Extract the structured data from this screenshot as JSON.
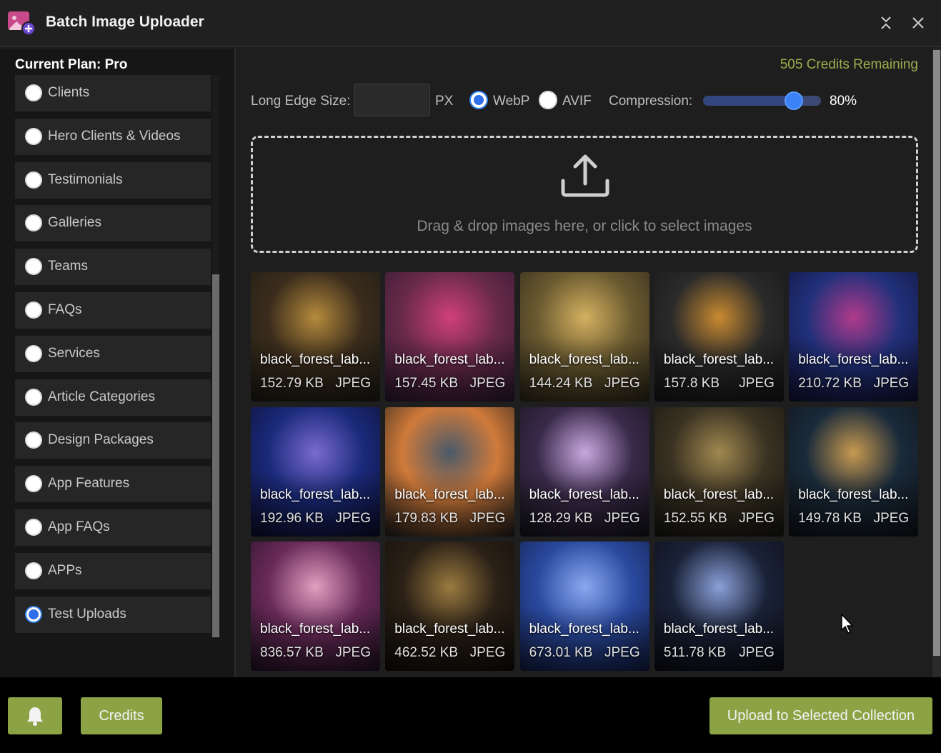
{
  "window": {
    "title": "Batch Image Uploader",
    "icon": "image-add-icon"
  },
  "sidebar": {
    "plan_label": "Current Plan: Pro",
    "collections": [
      {
        "label": "Clients",
        "checked": false
      },
      {
        "label": "Hero Clients & Videos",
        "checked": false
      },
      {
        "label": "Testimonials",
        "checked": false
      },
      {
        "label": "Galleries",
        "checked": false
      },
      {
        "label": "Teams",
        "checked": false
      },
      {
        "label": "FAQs",
        "checked": false
      },
      {
        "label": "Services",
        "checked": false
      },
      {
        "label": "Article Categories",
        "checked": false
      },
      {
        "label": "Design Packages",
        "checked": false
      },
      {
        "label": "App Features",
        "checked": false
      },
      {
        "label": "App FAQs",
        "checked": false
      },
      {
        "label": "APPs",
        "checked": false
      },
      {
        "label": "Test Uploads",
        "checked": true
      }
    ]
  },
  "options": {
    "credits_remaining": "505 Credits Remaining",
    "long_edge_label": "Long Edge Size:",
    "long_edge_value": "",
    "unit": "PX",
    "format_webp": "WebP",
    "format_avif": "AVIF",
    "selected_format": "WebP",
    "compression_label": "Compression:",
    "compression_value": "80%",
    "compression_fraction": 0.8
  },
  "dropzone": {
    "text": "Drag & drop images here, or click to select images",
    "icon": "upload-icon"
  },
  "images": [
    {
      "name": "black_forest_lab...",
      "size": "152.79 KB",
      "format": "JPEG",
      "colors": [
        "#3a2c1c",
        "#b58a3c",
        "#1c1a14"
      ]
    },
    {
      "name": "black_forest_lab...",
      "size": "157.45 KB",
      "format": "JPEG",
      "colors": [
        "#6a2a4a",
        "#d0407a",
        "#2a1830"
      ]
    },
    {
      "name": "black_forest_lab...",
      "size": "144.24 KB",
      "format": "JPEG",
      "colors": [
        "#6a5a30",
        "#d4b060",
        "#2a2418"
      ]
    },
    {
      "name": "black_forest_lab...",
      "size": "157.8 KB",
      "format": "JPEG",
      "colors": [
        "#2a2a2a",
        "#c98a30",
        "#151515"
      ]
    },
    {
      "name": "black_forest_lab...",
      "size": "210.72 KB",
      "format": "JPEG",
      "colors": [
        "#20307a",
        "#b03a8a",
        "#101030"
      ]
    },
    {
      "name": "black_forest_lab...",
      "size": "192.96 KB",
      "format": "JPEG",
      "colors": [
        "#1a2a7a",
        "#7a6ad0",
        "#0c0c2a"
      ]
    },
    {
      "name": "black_forest_lab...",
      "size": "179.83 KB",
      "format": "JPEG",
      "colors": [
        "#d07a3a",
        "#4a5a6a",
        "#1a1a1a"
      ]
    },
    {
      "name": "black_forest_lab...",
      "size": "128.29 KB",
      "format": "JPEG",
      "colors": [
        "#3a2a4a",
        "#c8a8e0",
        "#121218"
      ]
    },
    {
      "name": "black_forest_lab...",
      "size": "152.55 KB",
      "format": "JPEG",
      "colors": [
        "#3a3222",
        "#a08850",
        "#141410"
      ]
    },
    {
      "name": "black_forest_lab...",
      "size": "149.78 KB",
      "format": "JPEG",
      "colors": [
        "#1a2a3a",
        "#c89a50",
        "#0e1218"
      ]
    },
    {
      "name": "black_forest_lab...",
      "size": "836.57 KB",
      "format": "JPEG",
      "colors": [
        "#6a2a5a",
        "#e0a0c0",
        "#1e1020"
      ]
    },
    {
      "name": "black_forest_lab...",
      "size": "462.52 KB",
      "format": "JPEG",
      "colors": [
        "#2a2016",
        "#9a7a40",
        "#100c08"
      ]
    },
    {
      "name": "black_forest_lab...",
      "size": "673.01 KB",
      "format": "JPEG",
      "colors": [
        "#2a4aa0",
        "#8aa8f0",
        "#101a40"
      ]
    },
    {
      "name": "black_forest_lab...",
      "size": "511.78 KB",
      "format": "JPEG",
      "colors": [
        "#1a2238",
        "#8aa0d8",
        "#0a0c14"
      ]
    }
  ],
  "footer": {
    "bell_icon": "bell-icon",
    "credits_label": "Credits",
    "upload_label": "Upload to Selected Collection"
  },
  "colors": {
    "accent_green": "#8ba344",
    "credits_text": "#9aae4c",
    "radio_blue": "#2f6fe8"
  }
}
